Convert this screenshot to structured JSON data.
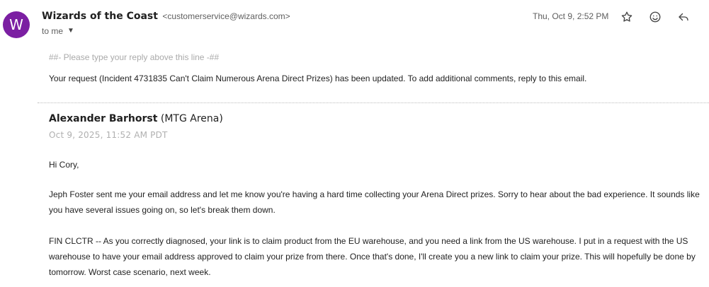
{
  "header": {
    "avatar_letter": "W",
    "sender_name": "Wizards of the Coast",
    "sender_email": "<customerservice@wizards.com>",
    "recipient": "to me",
    "date": "Thu, Oct 9, 2:52 PM",
    "icons": [
      "star-icon",
      "emoji-icon",
      "reply-icon"
    ]
  },
  "body": {
    "reply_marker": "##- Please type your reply above this line -##",
    "update_text": "Your request (Incident 4731835 Can't Claim Numerous Arena Direct Prizes) has been updated. To add additional comments, reply to this email.",
    "agent_name": "Alexander Barhorst",
    "agent_org": "(MTG Arena)",
    "agent_date": "Oct 9, 2025, 11:52 AM PDT",
    "greeting": "Hi Cory,",
    "p2_line1": "Jeph Foster sent me your email address and let me know you're having a hard time collecting your Arena Direct prizes. Sorry to hear about the bad experience. It sounds like",
    "p2_line2": "you have several issues going on, so let's break them down.",
    "p3_line1": "FIN CLCTR -- As you correctly diagnosed, your link is to claim product from the EU warehouse, and you need a link from the US warehouse. I put in a request with the US",
    "p3_line2": "warehouse to have your email address approved to claim your prize from there. Once that's done, I'll create you a new link to claim your prize. This will hopefully be done by",
    "p3_line3": "tomorrow. Worst case scenario, next week."
  },
  "colors": {
    "avatar": "#7b1fa2",
    "muted": "#aaaaaa"
  }
}
